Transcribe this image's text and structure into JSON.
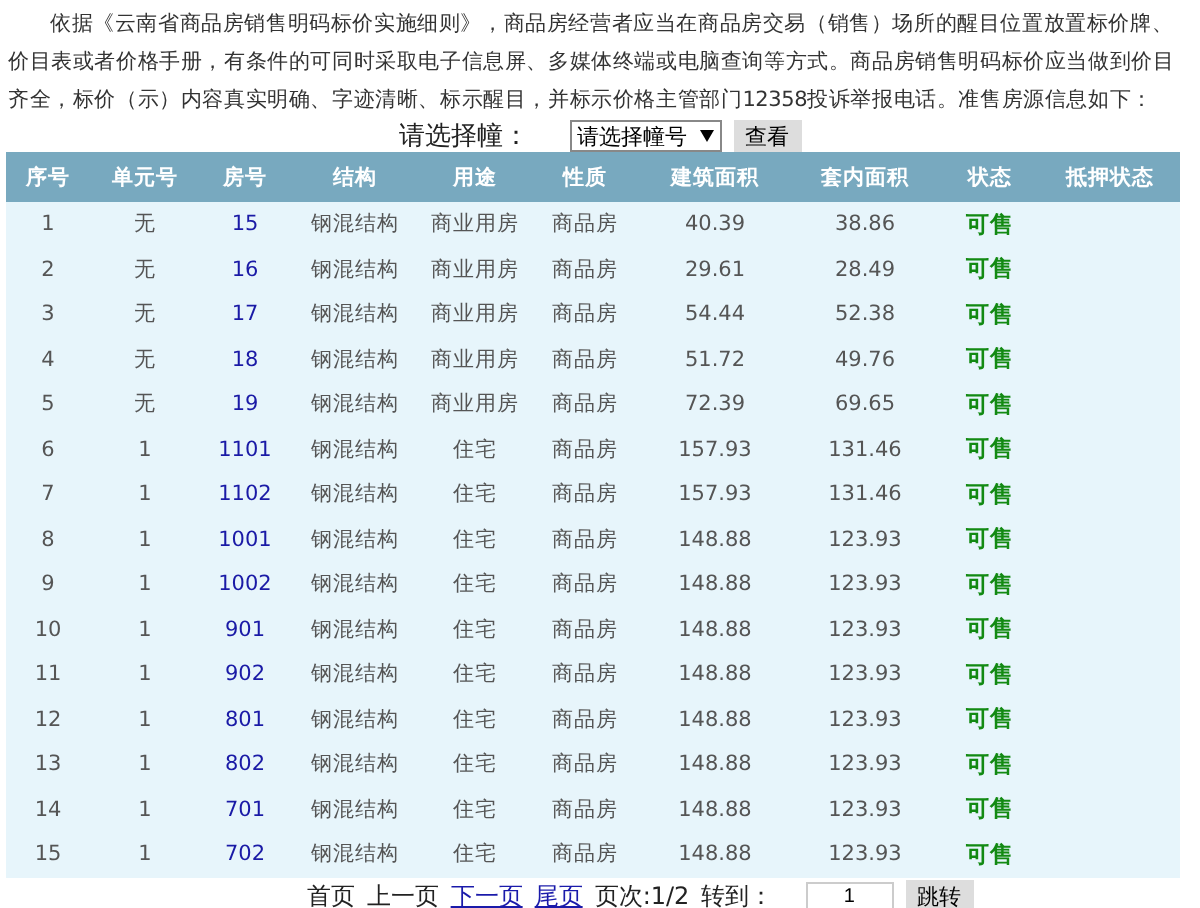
{
  "notice": "依据《云南省商品房销售明码标价实施细则》，商品房经营者应当在商品房交易（销售）场所的醒目位置放置标价牌、价目表或者价格手册，有条件的可同时采取电子信息屏、多媒体终端或电脑查询等方式。商品房销售明码标价应当做到价目齐全，标价（示）内容真实明确、字迹清晰、标示醒目，并标示价格主管部门12358投诉举报电话。准售房源信息如下：",
  "building_picker": {
    "label": "请选择幢：",
    "value": "请选择幢号",
    "button": "查看"
  },
  "table": {
    "columns": [
      "序号",
      "单元号",
      "房号",
      "结构",
      "用途",
      "性质",
      "建筑面积",
      "套内面积",
      "状态",
      "抵押状态"
    ],
    "rows": [
      [
        "1",
        "无",
        "15",
        "钢混结构",
        "商业用房",
        "商品房",
        "40.39",
        "38.86",
        "可售"
      ],
      [
        "2",
        "无",
        "16",
        "钢混结构",
        "商业用房",
        "商品房",
        "29.61",
        "28.49",
        "可售"
      ],
      [
        "3",
        "无",
        "17",
        "钢混结构",
        "商业用房",
        "商品房",
        "54.44",
        "52.38",
        "可售"
      ],
      [
        "4",
        "无",
        "18",
        "钢混结构",
        "商业用房",
        "商品房",
        "51.72",
        "49.76",
        "可售"
      ],
      [
        "5",
        "无",
        "19",
        "钢混结构",
        "商业用房",
        "商品房",
        "72.39",
        "69.65",
        "可售"
      ],
      [
        "6",
        "1",
        "1101",
        "钢混结构",
        "住宅",
        "商品房",
        "157.93",
        "131.46",
        "可售"
      ],
      [
        "7",
        "1",
        "1102",
        "钢混结构",
        "住宅",
        "商品房",
        "157.93",
        "131.46",
        "可售"
      ],
      [
        "8",
        "1",
        "1001",
        "钢混结构",
        "住宅",
        "商品房",
        "148.88",
        "123.93",
        "可售"
      ],
      [
        "9",
        "1",
        "1002",
        "钢混结构",
        "住宅",
        "商品房",
        "148.88",
        "123.93",
        "可售"
      ],
      [
        "10",
        "1",
        "901",
        "钢混结构",
        "住宅",
        "商品房",
        "148.88",
        "123.93",
        "可售"
      ],
      [
        "11",
        "1",
        "902",
        "钢混结构",
        "住宅",
        "商品房",
        "148.88",
        "123.93",
        "可售"
      ],
      [
        "12",
        "1",
        "801",
        "钢混结构",
        "住宅",
        "商品房",
        "148.88",
        "123.93",
        "可售"
      ],
      [
        "13",
        "1",
        "802",
        "钢混结构",
        "住宅",
        "商品房",
        "148.88",
        "123.93",
        "可售"
      ],
      [
        "14",
        "1",
        "701",
        "钢混结构",
        "住宅",
        "商品房",
        "148.88",
        "123.93",
        "可售"
      ],
      [
        "15",
        "1",
        "702",
        "钢混结构",
        "住宅",
        "商品房",
        "148.88",
        "123.93",
        "可售"
      ]
    ]
  },
  "pagination": {
    "links": [
      {
        "label": "首页",
        "disabled": true
      },
      {
        "label": "上一页",
        "disabled": true
      },
      {
        "label": "下一页",
        "disabled": false
      },
      {
        "label": "尾页",
        "disabled": false
      }
    ],
    "page_info": "页次:1/2",
    "goto_label": "转到：",
    "goto_value": "1",
    "goto_button": "跳转"
  }
}
